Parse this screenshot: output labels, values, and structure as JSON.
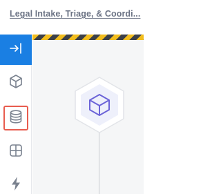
{
  "header": {
    "title": "Legal Intake, Triage, & Coordi..."
  },
  "sidebar": {
    "items": [
      {
        "name": "expand",
        "icon": "expand-panel-icon",
        "active": true
      },
      {
        "name": "components",
        "icon": "cube-icon"
      },
      {
        "name": "data",
        "icon": "database-icon",
        "highlighted": true
      },
      {
        "name": "layout",
        "icon": "grid-icon"
      },
      {
        "name": "actions",
        "icon": "lightning-icon"
      }
    ]
  },
  "canvas": {
    "node": {
      "icon": "cube-icon"
    }
  },
  "colors": {
    "accent": "#1a7fe3",
    "highlight": "#e85c4e",
    "node_icon": "#6b63d8",
    "hazard_yellow": "#f2bd1d",
    "hazard_dark": "#3c4048",
    "title_text": "#6b7384"
  }
}
